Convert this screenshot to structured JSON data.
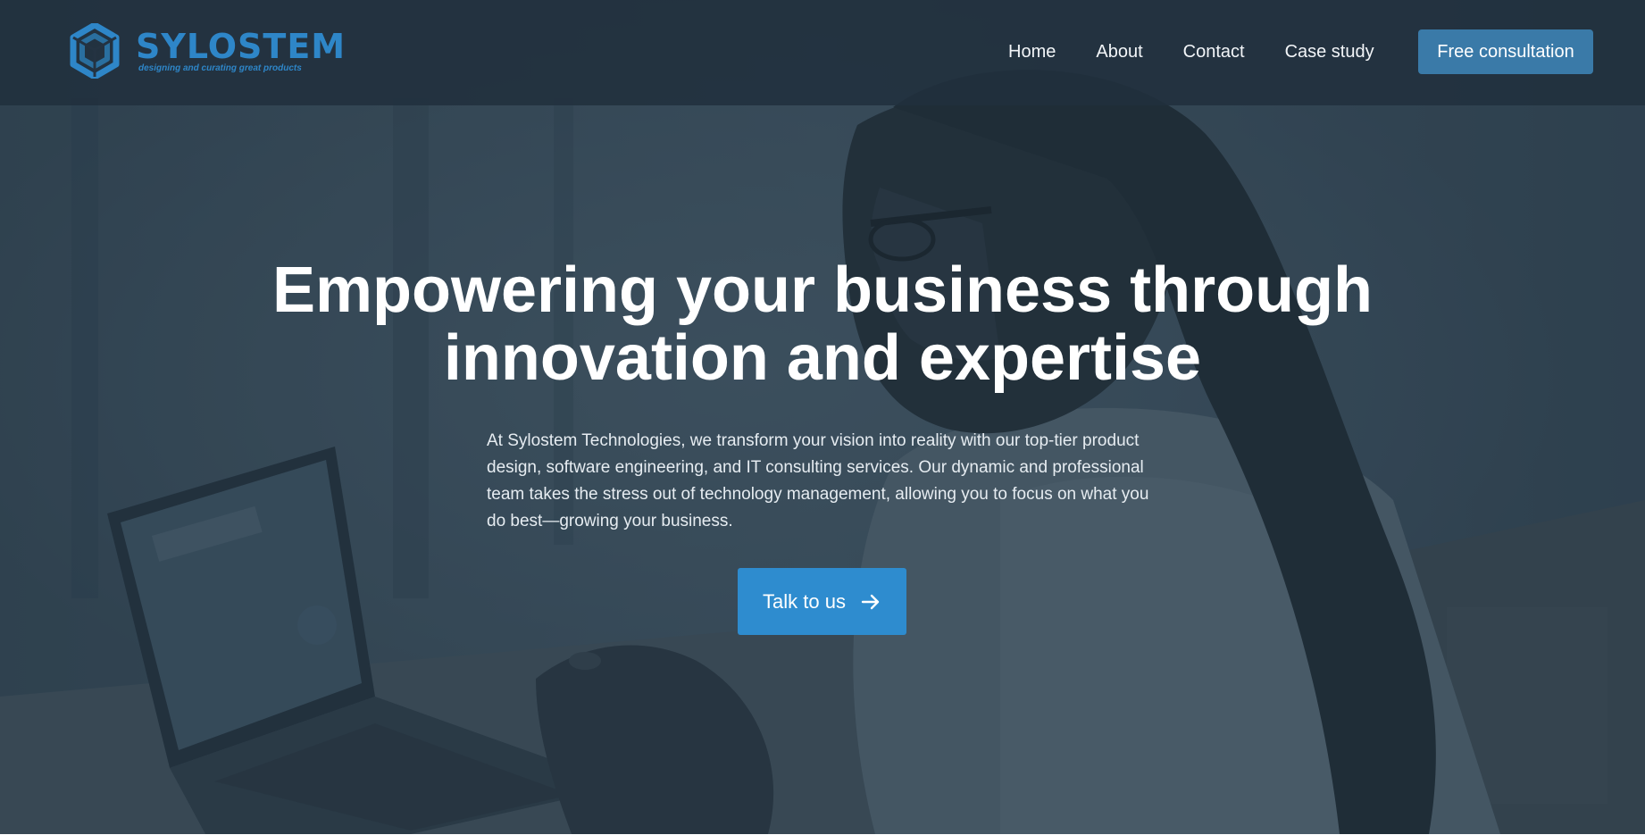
{
  "brand": {
    "name": "SYLOSTEM",
    "tagline": "designing and curating great products",
    "accent_color": "#2e86c8"
  },
  "nav": {
    "links": [
      {
        "label": "Home"
      },
      {
        "label": "About"
      },
      {
        "label": "Contact"
      },
      {
        "label": "Case study"
      }
    ],
    "cta_label": "Free consultation",
    "cta_color": "#3a7aa8"
  },
  "hero": {
    "headline_line1": "Empowering your business through",
    "headline_line2": "innovation and expertise",
    "description": "At Sylostem Technologies, we transform your vision into reality with our top-tier product design, software engineering, and IT consulting services. Our dynamic and professional team takes the stress out of technology management, allowing you to focus on what you do best—growing your business.",
    "button_label": "Talk to us",
    "button_icon": "arrow-right-icon",
    "button_color": "#2e8ccf",
    "background_image": "woman-with-braids-working-at-laptop-photo"
  }
}
